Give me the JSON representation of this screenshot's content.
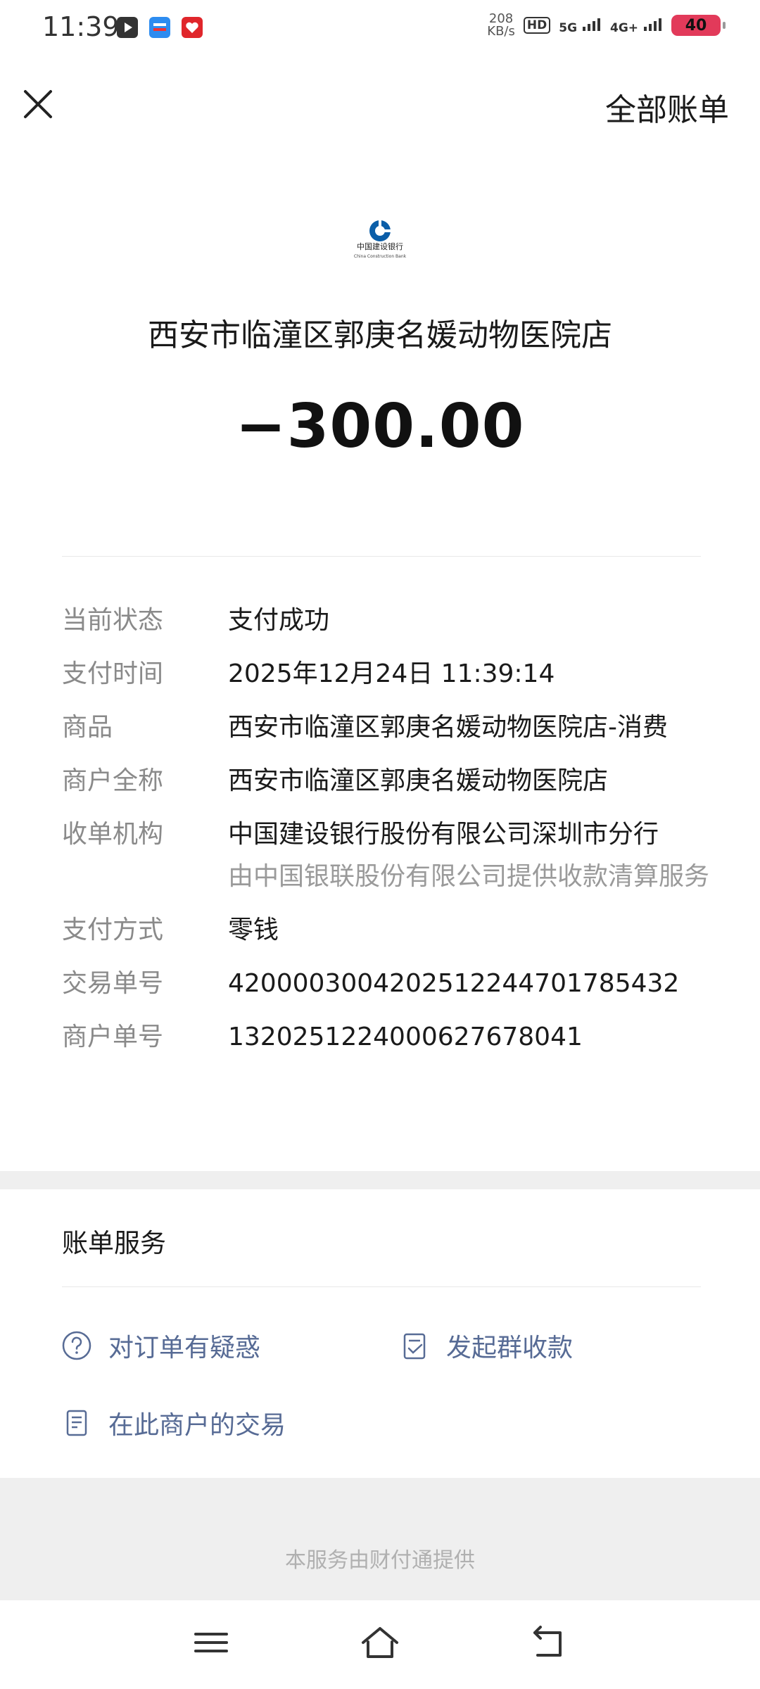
{
  "status_bar": {
    "time": "11:39",
    "net_speed_value": "208",
    "net_speed_unit": "KB/s",
    "hd": "HD",
    "sim1": "5G",
    "sim2": "4G+",
    "battery": "40"
  },
  "nav": {
    "all_bills": "全部账单"
  },
  "merchant": {
    "bank_logo_text": "中国建设银行",
    "bank_logo_en": "China Construction Bank",
    "name": "西安市临潼区郭庚名媛动物医院店",
    "amount": "−300.00"
  },
  "details": [
    {
      "label": "当前状态",
      "value": "支付成功"
    },
    {
      "label": "支付时间",
      "value": "2025年12月24日 11:39:14"
    },
    {
      "label": "商品",
      "value": "西安市临潼区郭庚名媛动物医院店-消费"
    },
    {
      "label": "商户全称",
      "value": "西安市临潼区郭庚名媛动物医院店"
    },
    {
      "label": "收单机构",
      "value": "中国建设银行股份有限公司深圳市分行",
      "sub": "由中国银联股份有限公司提供收款清算服务"
    },
    {
      "label": "支付方式",
      "value": "零钱"
    },
    {
      "label": "交易单号",
      "value": "4200003004202512244701785432"
    },
    {
      "label": "商户单号",
      "value": "132025122400062767804​1"
    }
  ],
  "services": {
    "title": "账单服务",
    "items": [
      {
        "label": "对订单有疑惑",
        "icon": "question-icon"
      },
      {
        "label": "发起群收款",
        "icon": "group-collect-icon"
      },
      {
        "label": "在此商户的交易",
        "icon": "document-icon"
      }
    ]
  },
  "footer": {
    "text": "本服务由财付通提供"
  },
  "colors": {
    "link": "#576b95",
    "label": "#8a8a8a",
    "bank_blue": "#0b5ea8"
  }
}
